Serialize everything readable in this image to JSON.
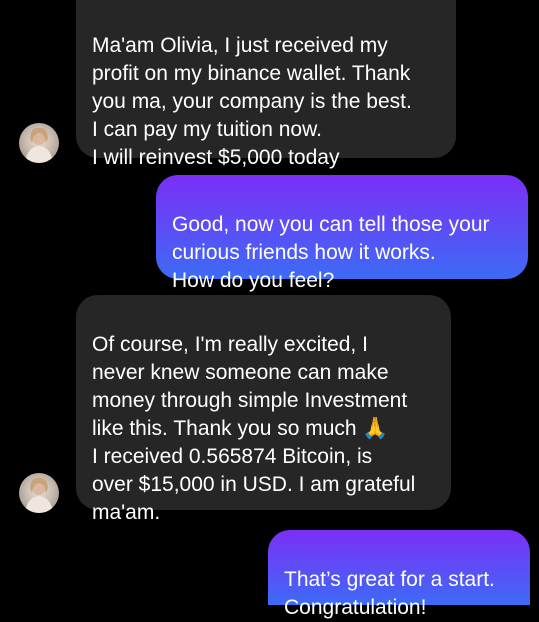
{
  "conversation": {
    "messages": [
      {
        "sender": "contact",
        "text": "Ma'am Olivia, I just received my\nprofit on my binance wallet. Thank\nyou ma, your company is the best.\nI can pay my tuition now.\nI will reinvest $5,000 today"
      },
      {
        "sender": "me",
        "text": "Good, now you can tell those your\ncurious friends how it works.\nHow do you feel?"
      },
      {
        "sender": "contact",
        "text": "Of course, I'm really excited, I\nnever knew someone can make\nmoney through simple Investment\nlike this. Thank you so much 🙏\nI received 0.565874 Bitcoin, is\nover $15,000 in USD. I am grateful\nma'am."
      },
      {
        "sender": "me",
        "text": "That’s great for a start.\nCongratulation!"
      }
    ]
  },
  "colors": {
    "background": "#000000",
    "received_bubble": "#262626",
    "sent_gradient_top": "#7b2ff7",
    "sent_gradient_bottom": "#3d6bf5",
    "text": "#ffffff"
  }
}
